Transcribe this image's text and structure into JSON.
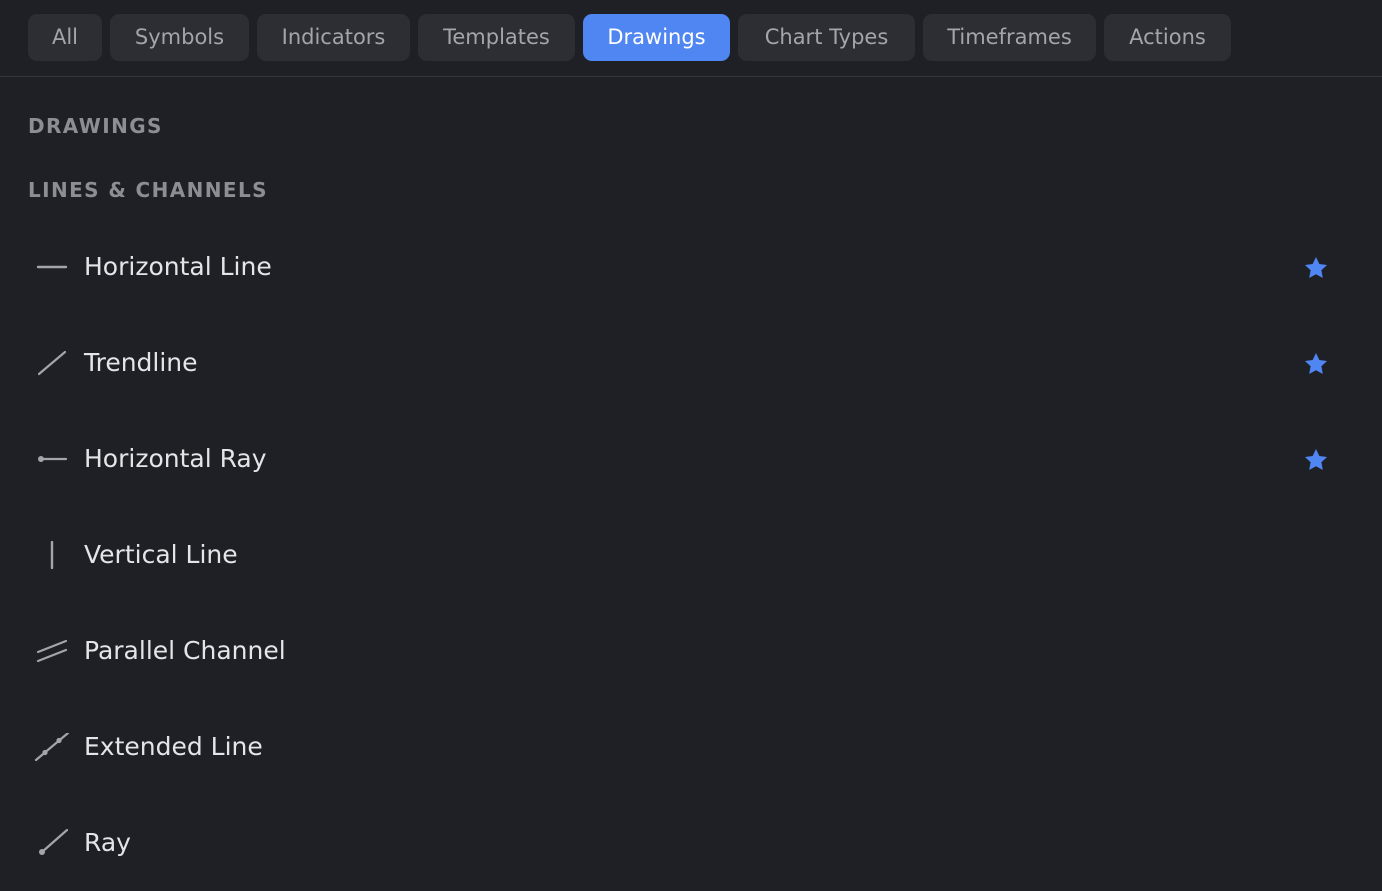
{
  "tabs": [
    {
      "label": "All",
      "active": false
    },
    {
      "label": "Symbols",
      "active": false
    },
    {
      "label": "Indicators",
      "active": false
    },
    {
      "label": "Templates",
      "active": false
    },
    {
      "label": "Drawings",
      "active": true
    },
    {
      "label": "Chart Types",
      "active": false
    },
    {
      "label": "Timeframes",
      "active": false
    },
    {
      "label": "Actions",
      "active": false
    }
  ],
  "section": {
    "title": "DRAWINGS",
    "group_title": "LINES & CHANNELS"
  },
  "items": [
    {
      "label": "Horizontal Line",
      "icon": "horizontal-line-icon",
      "favorite": true
    },
    {
      "label": "Trendline",
      "icon": "trendline-icon",
      "favorite": true
    },
    {
      "label": "Horizontal Ray",
      "icon": "horizontal-ray-icon",
      "favorite": true
    },
    {
      "label": "Vertical Line",
      "icon": "vertical-line-icon",
      "favorite": false
    },
    {
      "label": "Parallel Channel",
      "icon": "parallel-channel-icon",
      "favorite": false
    },
    {
      "label": "Extended Line",
      "icon": "extended-line-icon",
      "favorite": false
    },
    {
      "label": "Ray",
      "icon": "ray-icon",
      "favorite": false
    }
  ],
  "colors": {
    "background": "#1f2025",
    "tab_background": "#2c2e34",
    "accent": "#4f86f2",
    "text_primary": "#e4e5e8",
    "text_muted": "#8c8e94"
  }
}
